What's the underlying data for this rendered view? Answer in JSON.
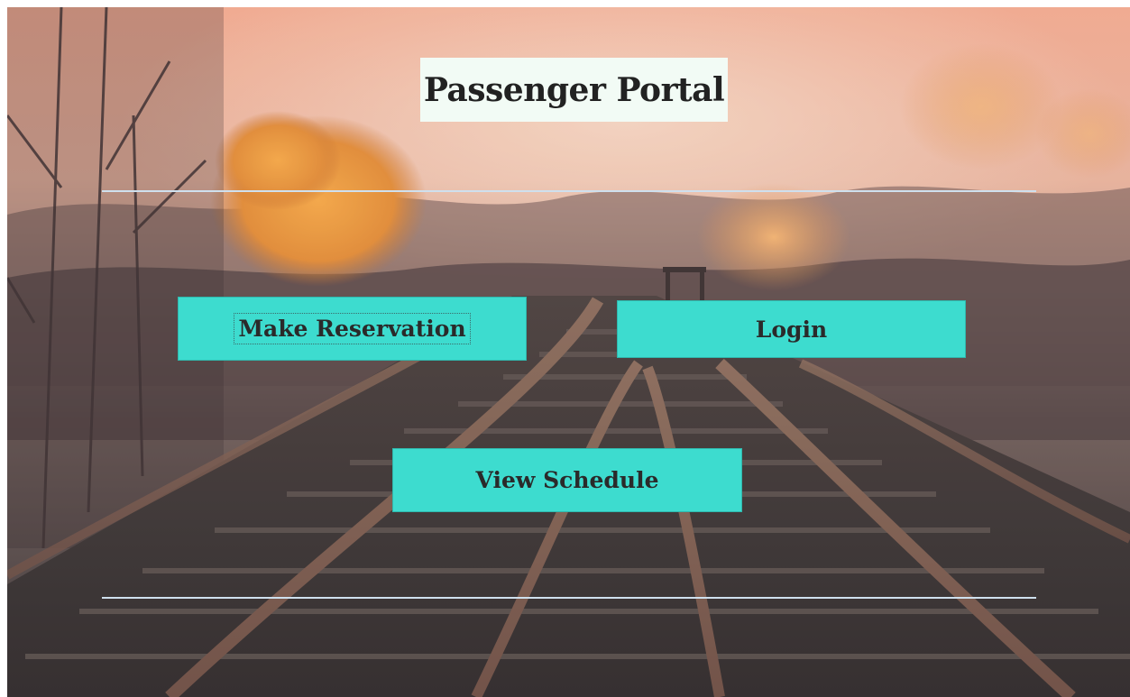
{
  "window": {
    "title": "Passenger Portal"
  },
  "buttons": {
    "make_reservation": "Make Reservation",
    "login": "Login",
    "view_schedule": "View Schedule"
  },
  "colors": {
    "button_bg": "#3ddccf",
    "heading_bg": "#f2fbf5",
    "divider": "#cfe0ee"
  }
}
